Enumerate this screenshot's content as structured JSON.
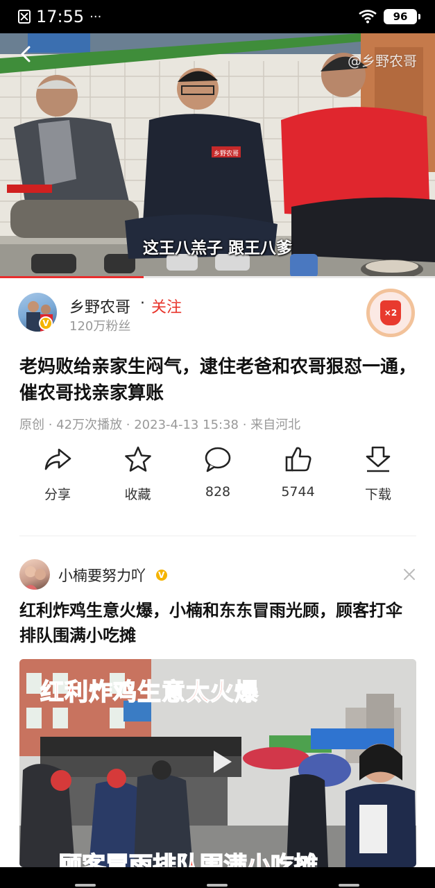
{
  "status_bar": {
    "time": "17:55",
    "dots": "···",
    "battery": "96",
    "icons": [
      "notification-muted-icon",
      "wifi-icon",
      "battery-icon"
    ]
  },
  "video": {
    "watermark": "@乡野农哥",
    "subtitle": "这王八羔子 跟王八爹",
    "shirt_text": "乡野农哥",
    "progress": 0.33
  },
  "author": {
    "name": "乡野农哥",
    "separator": "·",
    "follow_label": "关注",
    "fans": "120万粉丝",
    "reward_badge": "×2"
  },
  "video_title": "老妈败给亲家生闷气，逮住老爸和农哥狠怼一通，催农哥找亲家算账",
  "meta": "原创 · 42万次播放 · 2023-4-13 15:38 · 来自河北",
  "actions": [
    {
      "icon": "share-icon",
      "label": "分享"
    },
    {
      "icon": "star-icon",
      "label": "收藏"
    },
    {
      "icon": "comment-icon",
      "label": "828"
    },
    {
      "icon": "thumbs-up-icon",
      "label": "5744"
    },
    {
      "icon": "download-icon",
      "label": "下载"
    }
  ],
  "next_card": {
    "author": "小楠要努力吖",
    "title": "红利炸鸡生意火爆，小楠和东东冒雨光顾，顾客打伞排队围满小吃摊",
    "thumb_overlay_top": "红利炸鸡生意太火爆",
    "thumb_overlay_bottom": "顾客冒雨排队围满小吃摊"
  },
  "colors": {
    "accent_red": "#e8352c",
    "verified_gold": "#f5b400",
    "muted_text": "#999999"
  }
}
